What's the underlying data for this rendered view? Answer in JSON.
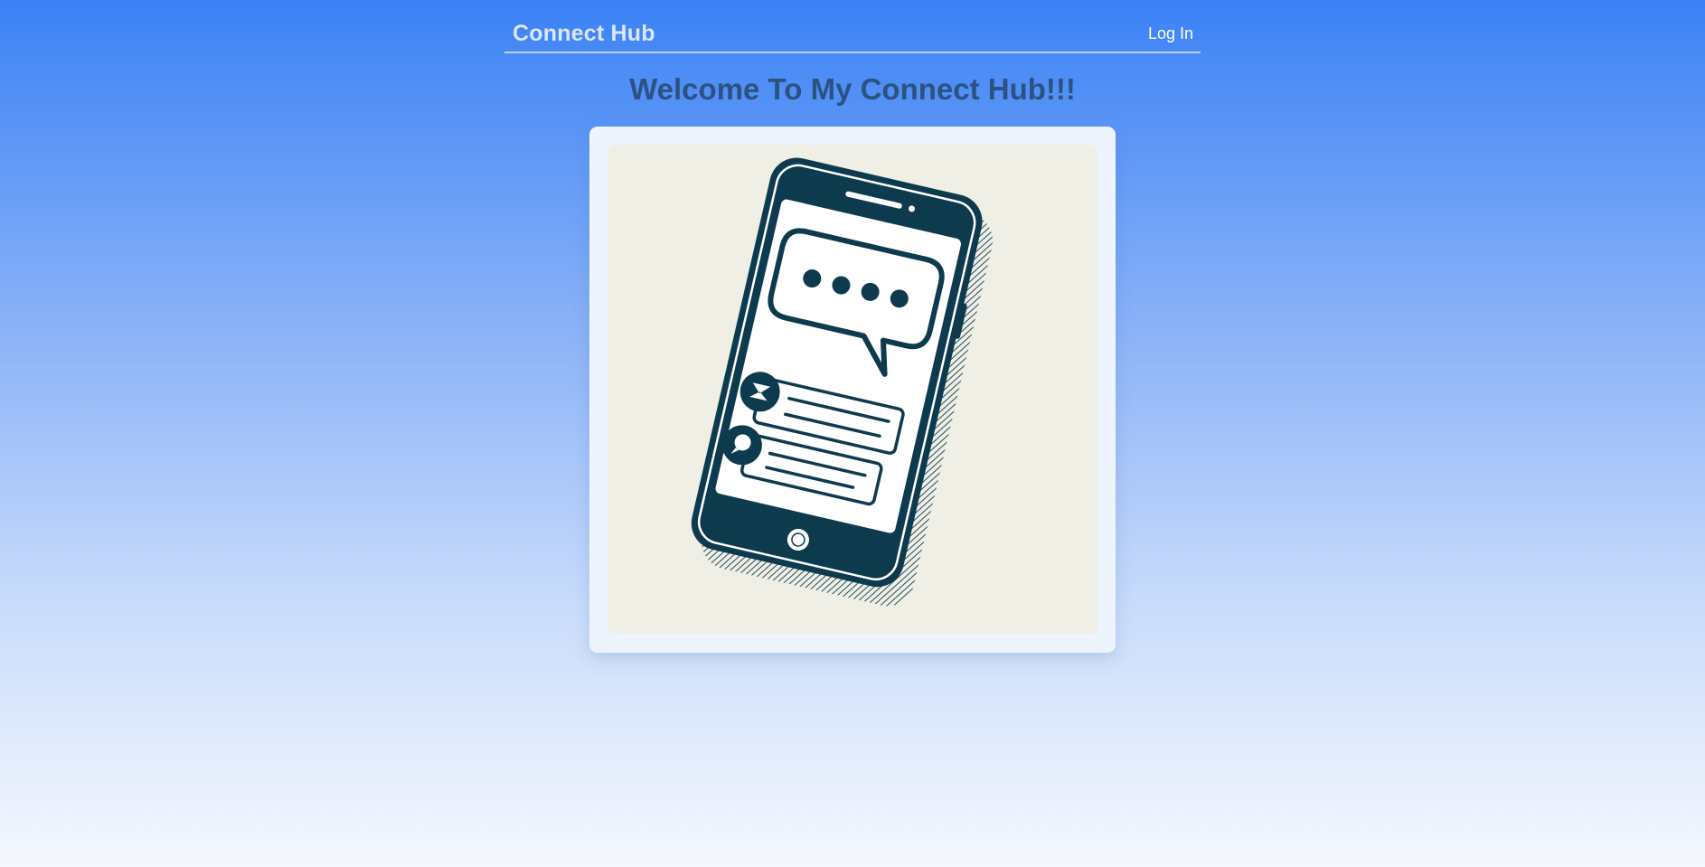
{
  "header": {
    "brand": "Connect Hub",
    "login_label": "Log In"
  },
  "main": {
    "heading": "Welcome To My Connect Hub!!!"
  },
  "colors": {
    "accent": "#3b82f6",
    "heading": "#2c5282",
    "ink": "#0d3a4d",
    "paper": "#efefe5"
  },
  "icons": {
    "hero": "smartphone-chat-illustration-icon"
  }
}
